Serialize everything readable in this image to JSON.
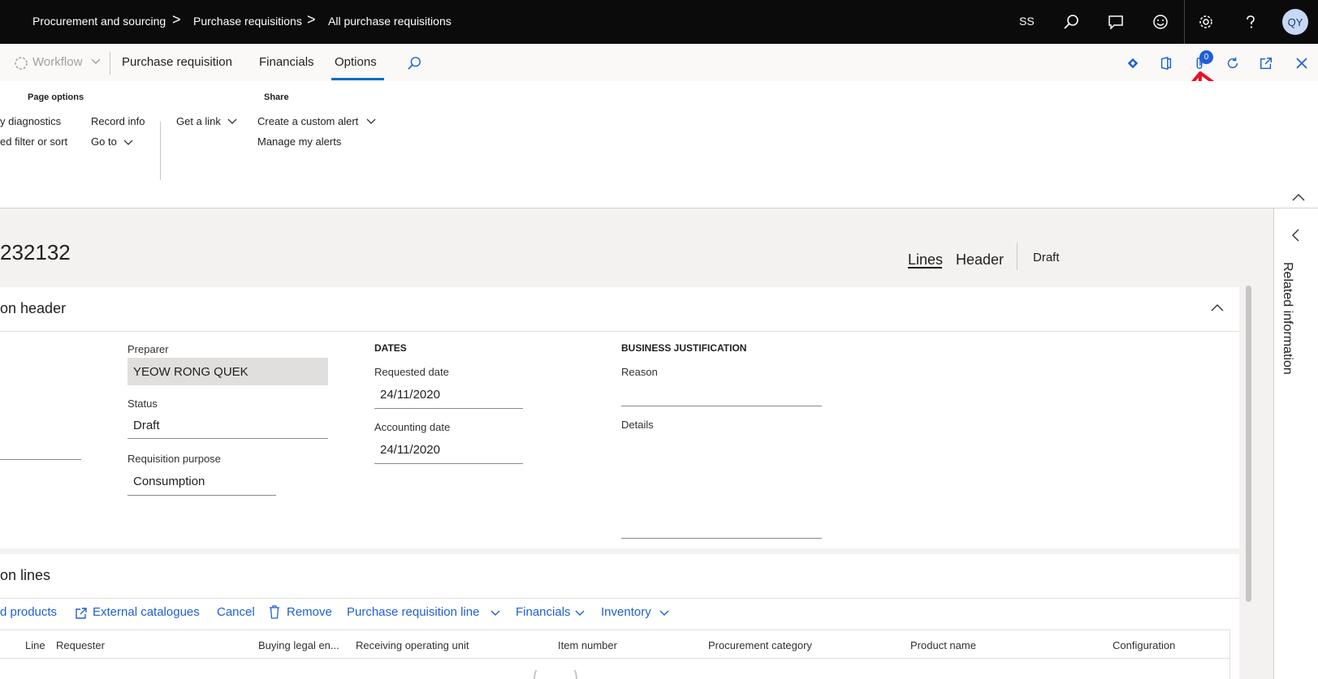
{
  "breadcrumb": {
    "items": [
      "Procurement and sourcing",
      "Purchase requisitions",
      "All purchase requisitions"
    ],
    "separator": ">"
  },
  "topbar": {
    "user_initials_text": "SS",
    "avatar_initials": "QY",
    "icons": [
      "search-icon",
      "chat-icon",
      "smiley-icon",
      "gear-icon",
      "help-icon"
    ]
  },
  "actionbar": {
    "workflow_label": "Workflow",
    "tabs": [
      "Purchase requisition",
      "Financials",
      "Options"
    ],
    "active_tab": "Options",
    "attachments_count": "0",
    "icons": [
      "search-icon",
      "power-apps-icon",
      "office-icon",
      "attach-icon",
      "refresh-icon",
      "open-new-window-icon",
      "close-icon"
    ]
  },
  "ribbon": {
    "page_options": {
      "heading": "Page options",
      "items": [
        "y diagnostics",
        "ed filter or sort",
        "Record info",
        "Go to"
      ]
    },
    "share": {
      "heading": "Share",
      "items": [
        "Get a link",
        "Create a custom alert",
        "Manage my alerts"
      ]
    }
  },
  "record": {
    "id_text": "232132",
    "view_tabs": [
      "Lines",
      "Header"
    ],
    "status": "Draft"
  },
  "header_section": {
    "title": "on header",
    "preparer_label": "Preparer",
    "preparer_value": "YEOW RONG QUEK",
    "status_label": "Status",
    "status_value": "Draft",
    "purpose_label": "Requisition purpose",
    "purpose_value": "Consumption",
    "dates_group": "DATES",
    "requested_date_label": "Requested date",
    "requested_date_value": "24/11/2020",
    "accounting_date_label": "Accounting date",
    "accounting_date_value": "24/11/2020",
    "justification_group": "BUSINESS JUSTIFICATION",
    "reason_label": "Reason",
    "details_label": "Details"
  },
  "lines_section": {
    "title": "on lines",
    "commands": [
      "d products",
      "External catalogues",
      "Cancel",
      "Remove",
      "Purchase requisition line",
      "Financials",
      "Inventory"
    ],
    "columns": [
      "Line",
      "Requester",
      "Buying legal en...",
      "Receiving operating unit",
      "Item number",
      "Procurement category",
      "Product name",
      "Configuration"
    ]
  },
  "related_panel": {
    "label": "Related information"
  },
  "colors": {
    "accent": "#1f5fd6",
    "topbar": "#0b0b0b",
    "annotation_arrow": "#e81123"
  }
}
